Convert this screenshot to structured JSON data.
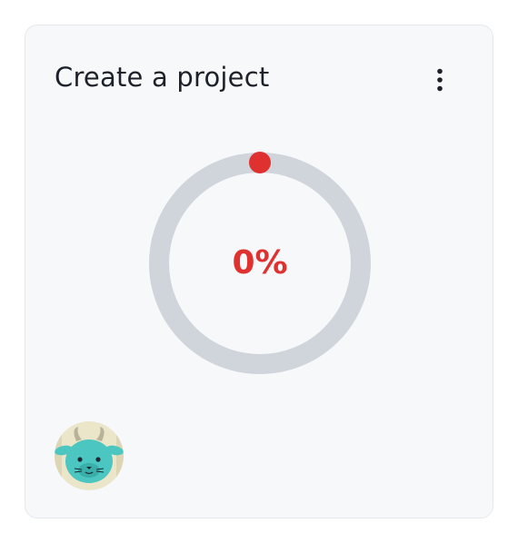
{
  "card": {
    "title": "Create a project",
    "menu_icon": "more-vertical-icon"
  },
  "progress": {
    "value": 0,
    "label": "0%",
    "track_color": "#d0d4db",
    "accent_color": "#e03131"
  },
  "avatar": {
    "icon": "goat-avatar-icon"
  }
}
